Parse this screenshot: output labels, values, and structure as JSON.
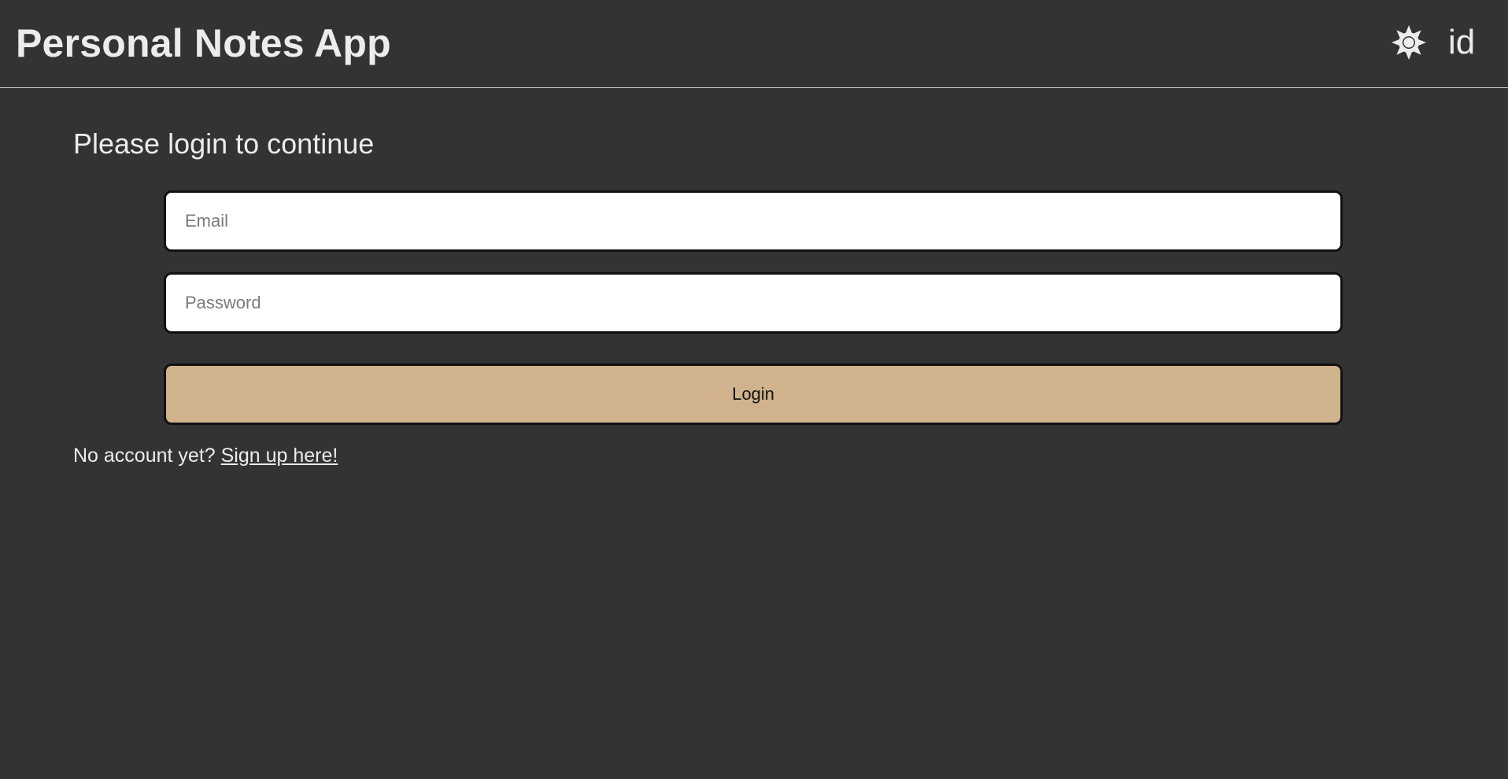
{
  "header": {
    "title": "Personal Notes App",
    "theme_icon": "sun-icon",
    "language_label": "id"
  },
  "login": {
    "heading": "Please login to continue",
    "email_placeholder": "Email",
    "email_value": "",
    "password_placeholder": "Password",
    "password_value": "",
    "button_label": "Login"
  },
  "signup": {
    "prompt": "No account yet?",
    "link_label": "Sign up here!"
  },
  "colors": {
    "background": "#333333",
    "text": "#ececec",
    "button_bg": "#d0b38c",
    "input_bg": "#ffffff"
  }
}
